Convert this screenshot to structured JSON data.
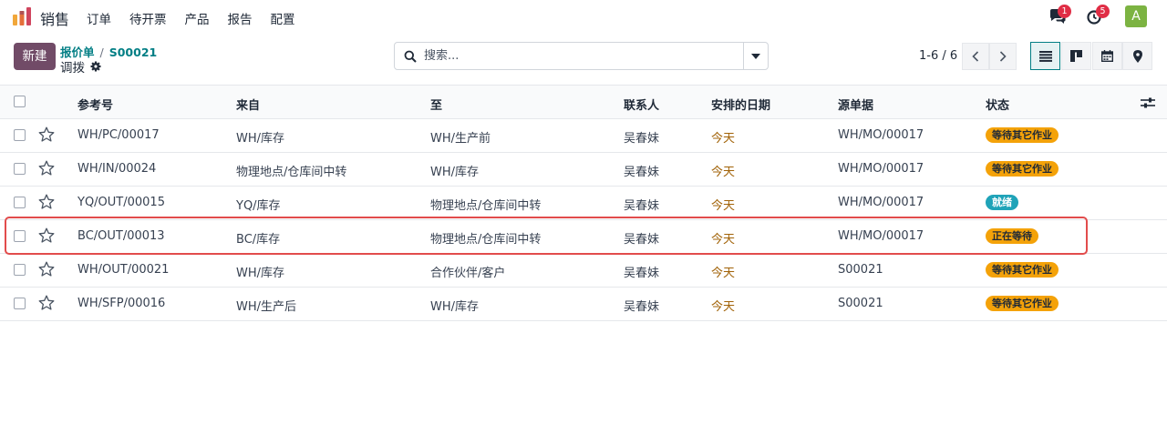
{
  "navbar": {
    "app_name": "销售",
    "menu": [
      "订单",
      "待开票",
      "产品",
      "报告",
      "配置"
    ],
    "messages_count": "1",
    "activities_count": "5",
    "avatar_letter": "A"
  },
  "control": {
    "new_label": "新建",
    "breadcrumb": [
      "报价单",
      "S00021"
    ],
    "subtitle": "调拨",
    "search_placeholder": "搜索...",
    "pager": "1-6 / 6"
  },
  "table": {
    "headers": [
      "参考号",
      "来自",
      "至",
      "联系人",
      "安排的日期",
      "源单据",
      "状态"
    ],
    "rows": [
      {
        "ref": "WH/PC/00017",
        "from": "WH/库存",
        "to": "WH/生产前",
        "contact": "吴春妹",
        "date": "今天",
        "source": "WH/MO/00017",
        "status": "等待其它作业",
        "status_kind": "wait"
      },
      {
        "ref": "WH/IN/00024",
        "from": "物理地点/仓库间中转",
        "to": "WH/库存",
        "contact": "吴春妹",
        "date": "今天",
        "source": "WH/MO/00017",
        "status": "等待其它作业",
        "status_kind": "wait"
      },
      {
        "ref": "YQ/OUT/00015",
        "from": "YQ/库存",
        "to": "物理地点/仓库间中转",
        "contact": "吴春妹",
        "date": "今天",
        "source": "WH/MO/00017",
        "status": "就绪",
        "status_kind": "ready"
      },
      {
        "ref": "BC/OUT/00013",
        "from": "BC/库存",
        "to": "物理地点/仓库间中转",
        "contact": "吴春妹",
        "date": "今天",
        "source": "WH/MO/00017",
        "status": "正在等待",
        "status_kind": "wait"
      },
      {
        "ref": "WH/OUT/00021",
        "from": "WH/库存",
        "to": "合作伙伴/客户",
        "contact": "吴春妹",
        "date": "今天",
        "source": "S00021",
        "status": "等待其它作业",
        "status_kind": "wait"
      },
      {
        "ref": "WH/SFP/00016",
        "from": "WH/生产后",
        "to": "WH/库存",
        "contact": "吴春妹",
        "date": "今天",
        "source": "S00021",
        "status": "等待其它作业",
        "status_kind": "wait"
      }
    ]
  },
  "colors": {
    "brand": "#714b67",
    "link": "#017e84",
    "badge": "#e02d45",
    "status_wait": "#f4a209",
    "status_ready": "#1fa3b8",
    "highlight": "#e24c4c"
  }
}
